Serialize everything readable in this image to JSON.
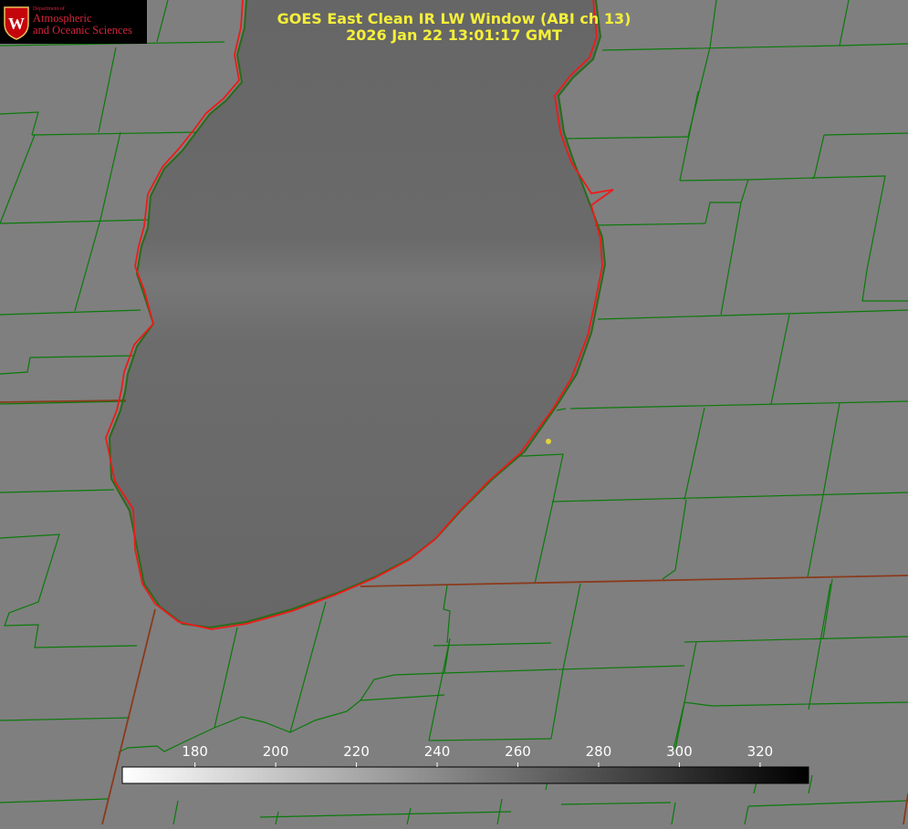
{
  "title": {
    "line1": "GOES East Clean IR LW Window (ABI ch 13)",
    "line2": "2026 Jan 22 13:01:17 GMT"
  },
  "logo": {
    "icon": "university-crest-icon",
    "small_text": "Department of",
    "line1": "Atmospheric",
    "line2": "and Oceanic Sciences"
  },
  "colorbar": {
    "ticks": [
      "180",
      "200",
      "220",
      "240",
      "260",
      "280",
      "300",
      "320"
    ],
    "range": [
      162,
      332
    ],
    "colormap": "white-to-black (inverted grayscale)"
  },
  "colors": {
    "background_gray": "#7f7f7f",
    "lake_gray": "#686868",
    "county_line": "#0a7a0a",
    "shoreline": "#ee1a1a",
    "title": "#f4ef3a",
    "marker": "#e3d23a"
  }
}
